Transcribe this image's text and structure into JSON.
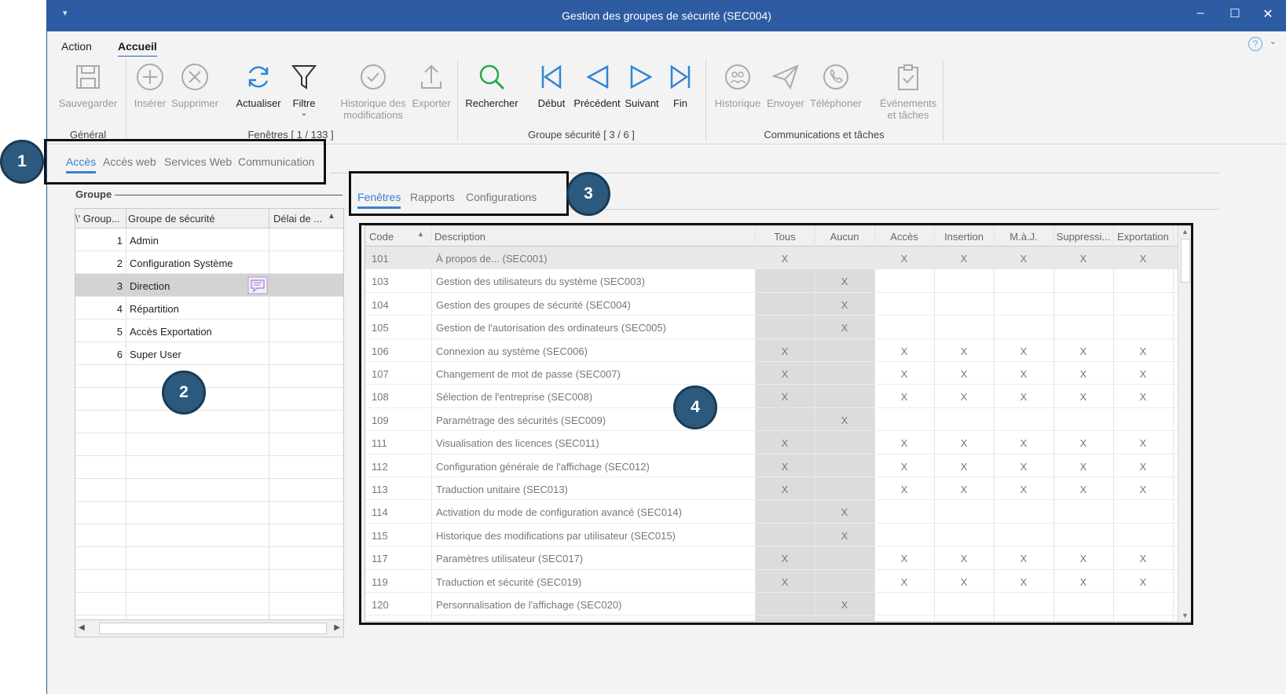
{
  "window": {
    "title": "Gestion des groupes de sécurité (SEC004)",
    "quick_access": "▾",
    "minimize": "–",
    "maximize": "☐",
    "close": "✕"
  },
  "menu": {
    "tabs": [
      {
        "label": "Action"
      },
      {
        "label": "Accueil"
      }
    ],
    "help_icon": "?",
    "help_chevron": "⌄"
  },
  "ribbon": {
    "buttons": {
      "save": "Sauvegarder",
      "insert": "Insérer",
      "delete": "Supprimer",
      "refresh": "Actualiser",
      "filter": "Filtre",
      "history_line1": "Historique des",
      "history_line2": "modifications",
      "export": "Exporter",
      "search": "Rechercher",
      "first": "Début",
      "previous": "Précédent",
      "next": "Suivant",
      "last": "Fin",
      "history2": "Historique",
      "send": "Envoyer",
      "phone": "Téléphoner",
      "events_line1": "Événements",
      "events_line2": "et tâches"
    },
    "filter_chevron": "⌄",
    "groups": {
      "general": "Général",
      "windows": "Fenêtres [ 1 / 133 ]",
      "security_group": "Groupe sécurité [ 3 / 6 ]",
      "communications": "Communications et tâches"
    }
  },
  "main_tabs": [
    {
      "label": "Accès"
    },
    {
      "label": "Accès web"
    },
    {
      "label": "Services Web"
    },
    {
      "label": "Communication"
    }
  ],
  "group_panel": {
    "title": "Groupe",
    "columns": [
      "\\' Group...",
      "Groupe de sécurité",
      "Délai de ..."
    ],
    "rows": [
      {
        "num": "1",
        "name": "Admin"
      },
      {
        "num": "2",
        "name": "Configuration Système"
      },
      {
        "num": "3",
        "name": "Direction"
      },
      {
        "num": "4",
        "name": "Répartition"
      },
      {
        "num": "5",
        "name": "Accès Exportation"
      },
      {
        "num": "6",
        "name": "Super User"
      }
    ],
    "scroll_left": "◀",
    "scroll_right": "▶"
  },
  "sub_tabs": [
    {
      "label": "Fenêtres"
    },
    {
      "label": "Rapports"
    },
    {
      "label": "Configurations"
    }
  ],
  "permissions": {
    "columns": [
      "Code",
      "Description",
      "Tous",
      "Aucun",
      "Accès",
      "Insertion",
      "M.à.J.",
      "Suppressi...",
      "Exportation"
    ],
    "rows": [
      {
        "code": "101",
        "desc": "À propos de... (SEC001)",
        "c": [
          "X",
          "",
          "X",
          "X",
          "X",
          "X",
          "X"
        ]
      },
      {
        "code": "103",
        "desc": "Gestion des utilisateurs du système (SEC003)",
        "c": [
          "",
          "X",
          "",
          "",
          "",
          "",
          ""
        ]
      },
      {
        "code": "104",
        "desc": "Gestion des groupes de sécurité (SEC004)",
        "c": [
          "",
          "X",
          "",
          "",
          "",
          "",
          ""
        ]
      },
      {
        "code": "105",
        "desc": "Gestion de l'autorisation des ordinateurs (SEC005)",
        "c": [
          "",
          "X",
          "",
          "",
          "",
          "",
          ""
        ]
      },
      {
        "code": "106",
        "desc": "Connexion au système (SEC006)",
        "c": [
          "X",
          "",
          "X",
          "X",
          "X",
          "X",
          "X"
        ]
      },
      {
        "code": "107",
        "desc": "Changement de mot de passe (SEC007)",
        "c": [
          "X",
          "",
          "X",
          "X",
          "X",
          "X",
          "X"
        ]
      },
      {
        "code": "108",
        "desc": "Sélection de l'entreprise (SEC008)",
        "c": [
          "X",
          "",
          "X",
          "X",
          "X",
          "X",
          "X"
        ]
      },
      {
        "code": "109",
        "desc": "Paramétrage des sécurités (SEC009)",
        "c": [
          "",
          "X",
          "",
          "",
          "",
          "",
          ""
        ]
      },
      {
        "code": "111",
        "desc": "Visualisation des licences (SEC011)",
        "c": [
          "X",
          "",
          "X",
          "X",
          "X",
          "X",
          "X"
        ]
      },
      {
        "code": "112",
        "desc": "Configuration générale de l'affichage (SEC012)",
        "c": [
          "X",
          "",
          "X",
          "X",
          "X",
          "X",
          "X"
        ]
      },
      {
        "code": "113",
        "desc": "Traduction unitaire (SEC013)",
        "c": [
          "X",
          "",
          "X",
          "X",
          "X",
          "X",
          "X"
        ]
      },
      {
        "code": "114",
        "desc": "Activation du mode de configuration avancé (SEC014)",
        "c": [
          "",
          "X",
          "",
          "",
          "",
          "",
          ""
        ]
      },
      {
        "code": "115",
        "desc": "Historique des modifications par utilisateur (SEC015)",
        "c": [
          "",
          "X",
          "",
          "",
          "",
          "",
          ""
        ]
      },
      {
        "code": "117",
        "desc": "Paramètres utilisateur (SEC017)",
        "c": [
          "X",
          "",
          "X",
          "X",
          "X",
          "X",
          "X"
        ]
      },
      {
        "code": "119",
        "desc": "Traduction et sécurité (SEC019)",
        "c": [
          "X",
          "",
          "X",
          "X",
          "X",
          "X",
          "X"
        ]
      },
      {
        "code": "120",
        "desc": "Personnalisation de l'affichage (SEC020)",
        "c": [
          "",
          "X",
          "",
          "",
          "",
          "",
          ""
        ]
      }
    ],
    "scroll_up": "▲",
    "scroll_down": "▼"
  },
  "callouts": [
    "1",
    "2",
    "3",
    "4"
  ]
}
